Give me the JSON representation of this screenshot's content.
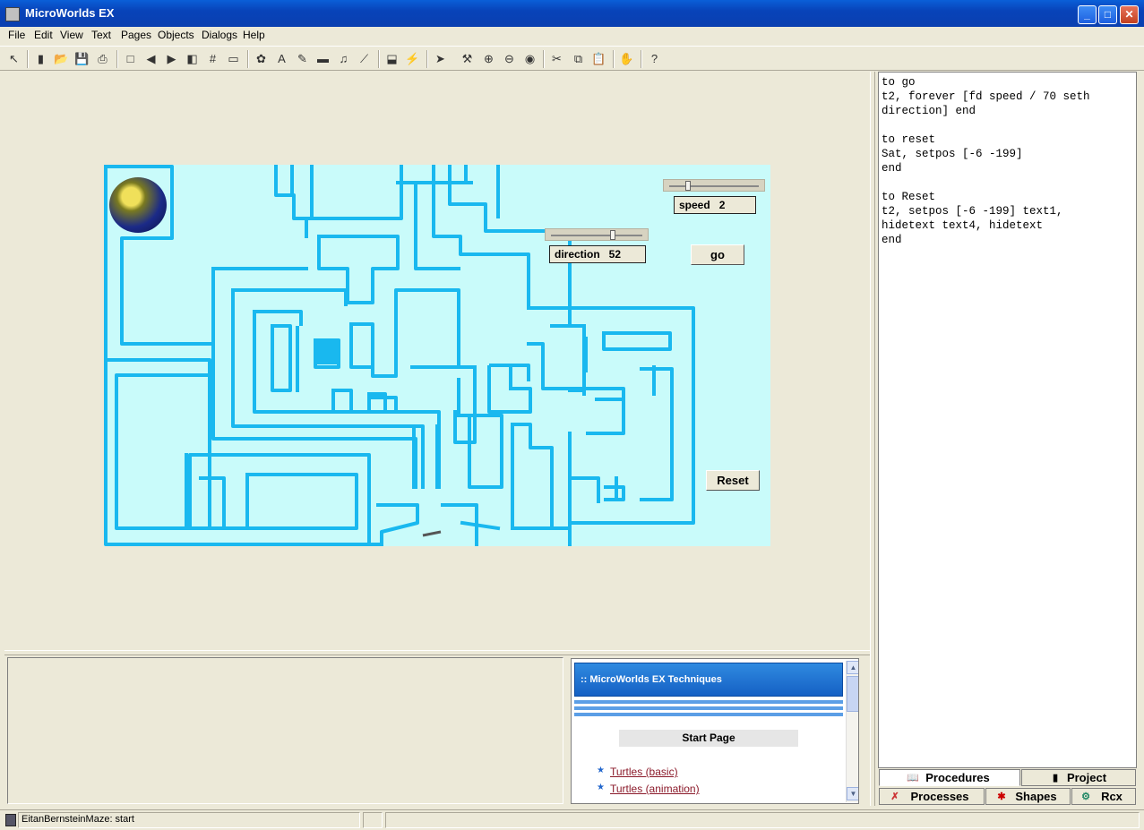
{
  "window": {
    "title": "MicroWorlds EX"
  },
  "menu": [
    "File",
    "Edit",
    "View",
    "Text",
    "Pages",
    "Objects",
    "Dialogs",
    "Help"
  ],
  "toolbar": [
    {
      "name": "pointer-tool-icon",
      "glyph": "↖"
    },
    {
      "name": "new-project-icon",
      "glyph": "▮"
    },
    {
      "name": "open-icon",
      "glyph": "📂"
    },
    {
      "name": "save-icon",
      "glyph": "💾"
    },
    {
      "name": "print-icon",
      "glyph": "⎙"
    },
    {
      "name": "new-page-icon",
      "glyph": "□"
    },
    {
      "name": "previous-page-icon",
      "glyph": "◀"
    },
    {
      "name": "next-page-icon",
      "glyph": "▶"
    },
    {
      "name": "page-view-icon",
      "glyph": "◧"
    },
    {
      "name": "grid-icon",
      "glyph": "#"
    },
    {
      "name": "frame-icon",
      "glyph": "▭"
    },
    {
      "name": "turtle-icon",
      "glyph": "✿"
    },
    {
      "name": "text-box-icon",
      "glyph": "A"
    },
    {
      "name": "paint-icon",
      "glyph": "✎"
    },
    {
      "name": "button-icon",
      "glyph": "▬"
    },
    {
      "name": "music-icon",
      "glyph": "♫"
    },
    {
      "name": "slider-icon",
      "glyph": "⟋"
    },
    {
      "name": "stamp-icon",
      "glyph": "⬓"
    },
    {
      "name": "magic-icon",
      "glyph": "⚡"
    },
    {
      "name": "select-arrow-icon",
      "glyph": "➤"
    },
    {
      "name": "hatch-icon",
      "glyph": "⚒"
    },
    {
      "name": "zoom-in-icon",
      "glyph": "⊕"
    },
    {
      "name": "zoom-out-icon",
      "glyph": "⊖"
    },
    {
      "name": "eye-icon",
      "glyph": "◉"
    },
    {
      "name": "cut-icon",
      "glyph": "✂"
    },
    {
      "name": "copy-icon",
      "glyph": "⧉"
    },
    {
      "name": "paste-icon",
      "glyph": "📋"
    },
    {
      "name": "stop-icon",
      "glyph": "✋"
    },
    {
      "name": "help-icon",
      "glyph": "?"
    }
  ],
  "stage": {
    "background": "#c9fbfa",
    "wall_color": "#19b8ef",
    "speed": {
      "label": "speed",
      "value": "2"
    },
    "direction": {
      "label": "direction",
      "value": "52"
    },
    "go_label": "go",
    "reset_label": "Reset"
  },
  "help": {
    "header": ":: MicroWorlds EX Techniques",
    "start_page": "Start Page",
    "links": [
      "Turtles (basic)",
      "Turtles (animation)"
    ]
  },
  "procedures_lines": [
    "to go",
    "t2, forever [fd speed / 70 seth",
    "direction] end",
    "",
    "to reset",
    "Sat, setpos [-6 -199]",
    "end",
    "",
    "to Reset",
    "t2, setpos [-6 -199] text1,",
    "hidetext text4, hidetext",
    "end"
  ],
  "tabs": {
    "procedures": "Procedures",
    "project": "Project",
    "processes": "Processes",
    "shapes": "Shapes",
    "rcx": "Rcx"
  },
  "status": {
    "text": "EitanBernsteinMaze:  start"
  }
}
